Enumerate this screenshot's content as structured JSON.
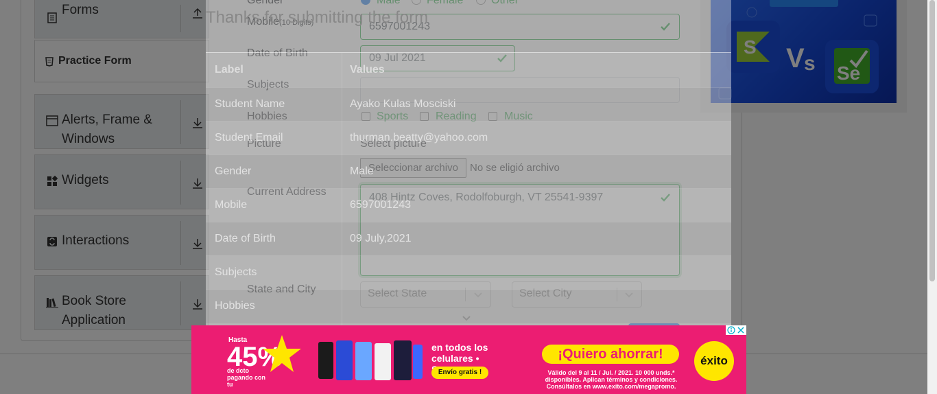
{
  "sidebar": {
    "groups": [
      {
        "label": "Forms",
        "icon": "document-icon"
      },
      {
        "label": "Alerts, Frame &",
        "label2": "Windows",
        "icon": "window-icon"
      },
      {
        "label": "Widgets",
        "icon": "widgets-icon"
      },
      {
        "label": "Interactions",
        "icon": "interactions-icon"
      },
      {
        "label": "Book Store",
        "label2": "Application",
        "icon": "books-icon"
      }
    ],
    "active_item": "Practice Form"
  },
  "form": {
    "gender_label": "Gender",
    "gender_options": [
      "Male",
      "Female",
      "Other"
    ],
    "mobile_label": "Mobile",
    "mobile_hint": "(10 Digits)",
    "mobile_value": "6597001243",
    "dob_label": "Date of Birth",
    "dob_value": "09 Jul 2021",
    "subjects_label": "Subjects",
    "hobbies_label": "Hobbies",
    "hobbies": [
      "Sports",
      "Reading",
      "Music"
    ],
    "picture_label": "Picture",
    "select_picture": "Select picture",
    "file_button": "Seleccionar archivo",
    "file_status": "No se eligió archivo",
    "address_label": "Current Address",
    "address_value": "408 Hintz Coves, Rodolfoburgh, VT 25541-9397",
    "state_city_label": "State and City",
    "state_placeholder": "Select State",
    "city_placeholder": "Select City"
  },
  "modal": {
    "title": "Thanks for submitting the form",
    "col_label": "Label",
    "col_values": "Values",
    "rows": [
      {
        "label": "Student Name",
        "value": "Ayako Kulas Mosciski"
      },
      {
        "label": "Student Email",
        "value": "thurman.beatty@yahoo.com"
      },
      {
        "label": "Gender",
        "value": "Male"
      },
      {
        "label": "Mobile",
        "value": "6597001243"
      },
      {
        "label": "Date of Birth",
        "value": "09 July,2021"
      },
      {
        "label": "Subjects",
        "value": ""
      },
      {
        "label": "Hobbies",
        "value": ""
      }
    ]
  },
  "ad_bottom": {
    "hasta": "Hasta",
    "percent": "45%",
    "sub": "de dcto pagando con tu",
    "headline": "en todos los celulares • Samsung.",
    "envio": "Envío gratis !",
    "cta": "¡Quiero ahorrar!",
    "legal": "Válido del 9 al 11 / Jul. / 2021. 10 000 unds.* disponibles. Aplican términos y condiciones. Consúltalos en www.exito.com/megapromo.",
    "brand": "éxito"
  },
  "colors": {
    "valid_green": "#28a745",
    "ad_pink": "#ec1d72",
    "ad_yellow": "#ffe600"
  }
}
